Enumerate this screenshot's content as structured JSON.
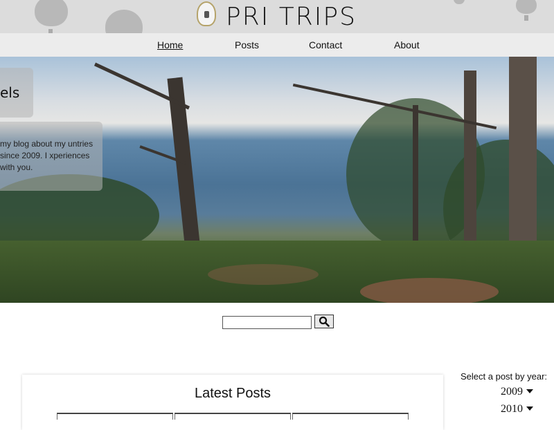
{
  "header": {
    "title": "PRI TRIPS",
    "logo_icon": "hot-air-balloon-logo-icon"
  },
  "nav": {
    "items": [
      {
        "label": "Home",
        "active": true
      },
      {
        "label": "Posts",
        "active": false
      },
      {
        "label": "Contact",
        "active": false
      },
      {
        "label": "About",
        "active": false
      }
    ]
  },
  "hero": {
    "heading": "els",
    "text": "my blog about my untries since 2009. I xperiences with you."
  },
  "search": {
    "value": "",
    "button_icon": "search-icon"
  },
  "latest_posts": {
    "title": "Latest Posts"
  },
  "year_selector": {
    "label": "Select a post by year:",
    "years": [
      "2009",
      "2010"
    ]
  }
}
